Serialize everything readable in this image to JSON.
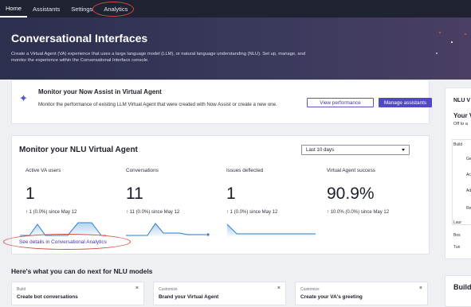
{
  "nav": {
    "tabs": [
      {
        "label": "Home",
        "active": true
      },
      {
        "label": "Assistants"
      },
      {
        "label": "Settings"
      },
      {
        "label": "Analytics"
      }
    ]
  },
  "hero": {
    "title": "Conversational Interfaces",
    "description": "Create a Virtual Agent (VA) experience that uses a large language model (LLM), or natural language understanding (NLU). Set up, manage, and monitor the experience within the Conversational Interface console."
  },
  "now_assist": {
    "icon": "sparkle-icon",
    "title": "Monitor your Now Assist in Virtual Agent",
    "subtitle": "Monitor the performance of existing LLM Virtual Agent that were created with Now Assist or create a new one.",
    "view_button": "View performance",
    "manage_button": "Manage assistants"
  },
  "nlu": {
    "title": "Monitor your NLU Virtual Agent",
    "range": "Last 10 days",
    "metrics": [
      {
        "label": "Active VA users",
        "value": "1",
        "change": "↑  1 (0.0%) since May 12"
      },
      {
        "label": "Conversations",
        "value": "11",
        "change": "↑  11 (0.0%) since May 12"
      },
      {
        "label": "Issues deflected",
        "value": "1",
        "change": "↑  1 (0.0%) since May 12"
      },
      {
        "label": "Virtual Agent success",
        "value": "90.9%",
        "change": "↑  10.0% (0.0%) since May 12"
      }
    ],
    "details_link": "See details in Conversational Analytics",
    "accent": "#5c55c7",
    "spark_color": "#2a7fd1"
  },
  "next": {
    "title": "Here's what you can do next for NLU models",
    "cards": [
      {
        "category": "Build",
        "name": "Create bot conversations"
      },
      {
        "category": "Customize",
        "name": "Brand your Virtual Agent"
      },
      {
        "category": "Customize",
        "name": "Create your VA's greeting"
      }
    ]
  },
  "side": {
    "title": "NLU V",
    "heading": "Your V",
    "sub": "Off to a",
    "rows": [
      "Build",
      "Ge",
      "Ac",
      "Ad",
      "Re",
      "Laur",
      "Bos",
      "Tun"
    ],
    "footer": "Build"
  }
}
